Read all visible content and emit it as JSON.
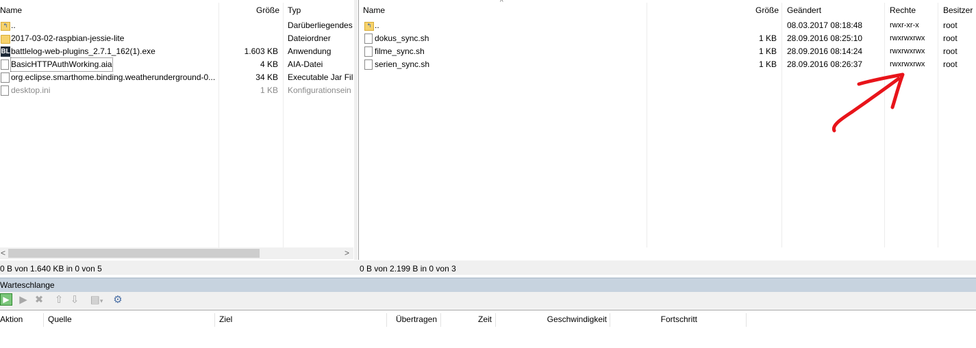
{
  "left_pane": {
    "columns": {
      "name": "Name",
      "size": "Größe",
      "type": "Typ"
    },
    "rows": [
      {
        "icon": "up-folder-icon",
        "name": "..",
        "size": "",
        "type": "Darüberliegendes",
        "dim": false
      },
      {
        "icon": "folder-icon",
        "name": "2017-03-02-raspbian-jessie-lite",
        "size": "",
        "type": "Dateiordner",
        "dim": false
      },
      {
        "icon": "exe-icon",
        "icon_text": "BL",
        "name": "battlelog-web-plugins_2.7.1_162(1).exe",
        "size": "1.603 KB",
        "type": "Anwendung",
        "dim": false
      },
      {
        "icon": "file-icon",
        "name": "BasicHTTPAuthWorking.aia",
        "size": "4 KB",
        "type": "AIA-Datei",
        "dim": false
      },
      {
        "icon": "jar-icon",
        "name": "org.eclipse.smarthome.binding.weatherunderground-0...",
        "size": "34 KB",
        "type": "Executable Jar File",
        "dim": false
      },
      {
        "icon": "ini-file-icon",
        "name": "desktop.ini",
        "size": "1 KB",
        "type": "Konfigurationsein",
        "dim": true
      }
    ],
    "status": "0 B von 1.640 KB in 0 von 5",
    "scroll_left": "<",
    "scroll_right": ">"
  },
  "right_pane": {
    "sort_indicator": "^",
    "columns": {
      "name": "Name",
      "size": "Größe",
      "modified": "Geändert",
      "perms": "Rechte",
      "owner": "Besitzer"
    },
    "rows": [
      {
        "icon": "up-folder-icon",
        "name": "..",
        "size": "",
        "modified": "08.03.2017 08:18:48",
        "perms": "rwxr-xr-x",
        "owner": "root"
      },
      {
        "icon": "file-icon",
        "name": "dokus_sync.sh",
        "size": "1 KB",
        "modified": "28.09.2016 08:25:10",
        "perms": "rwxrwxrwx",
        "owner": "root"
      },
      {
        "icon": "file-icon",
        "name": "filme_sync.sh",
        "size": "1 KB",
        "modified": "28.09.2016 08:14:24",
        "perms": "rwxrwxrwx",
        "owner": "root"
      },
      {
        "icon": "file-icon",
        "name": "serien_sync.sh",
        "size": "1 KB",
        "modified": "28.09.2016 08:26:37",
        "perms": "rwxrwxrwx",
        "owner": "root"
      }
    ],
    "status": "0 B von 2.199 B in 0 von 3"
  },
  "queue": {
    "title": "Warteschlange",
    "toolbar_icons": [
      "process-queue-icon",
      "play-icon",
      "stop-icon",
      "move-up-icon",
      "move-down-icon",
      "preferences-icon",
      "settings-gear-icon"
    ],
    "columns": {
      "action": "Aktion",
      "source": "Quelle",
      "target": "Ziel",
      "transferred": "Übertragen",
      "time": "Zeit",
      "speed": "Geschwindigkeit",
      "progress": "Fortschritt"
    }
  },
  "annotation": {
    "color": "#e8141a",
    "icon": "red-arrow-annotation"
  }
}
